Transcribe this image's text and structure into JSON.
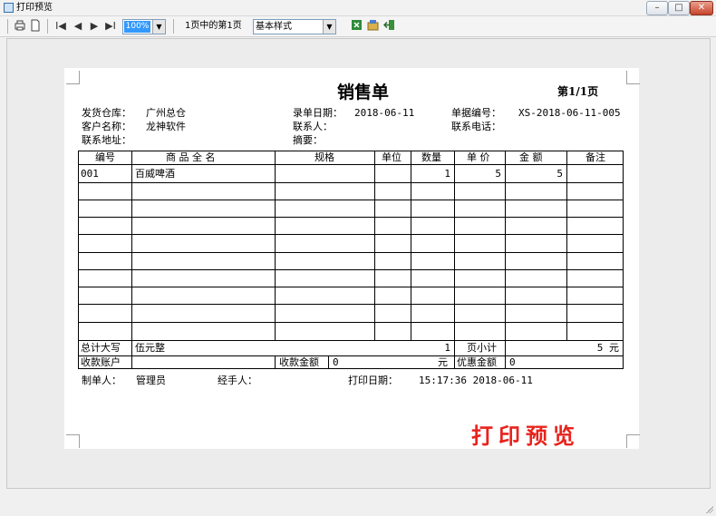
{
  "window": {
    "title": "打印预览",
    "min": "–",
    "max": "□",
    "close": "✕"
  },
  "toolbar": {
    "print_icon": "printer-icon",
    "page_setup_icon": "page-icon",
    "first_page": "I◀",
    "prev_page": "◀",
    "next_page": "▶",
    "last_page": "▶I",
    "zoom_value": "100%",
    "zoom_arrow": "▼",
    "page_label": "1页中的第1页",
    "style_value": "基本样式",
    "style_arrow": "▼",
    "excel_icon": "excel-icon",
    "design_icon": "design-icon",
    "exit_icon": "exit-icon"
  },
  "doc": {
    "title": "销售单",
    "page_no": "第1/1页",
    "warehouse_label": "发货仓库：",
    "warehouse_value": "广州总仓",
    "entry_date_label": "录单日期：",
    "entry_date_value": "2018-06-11",
    "doc_no_label": "单据编号：",
    "doc_no_value": "XS-2018-06-11-005",
    "customer_label": "客户名称：",
    "customer_value": "龙神软件",
    "contact_label": "联系人：",
    "phone_label": "联系电话：",
    "address_label": "联系地址：",
    "summary_label": "摘要："
  },
  "table": {
    "headers": [
      "编号",
      "商 品 全 名",
      "规格",
      "单位",
      "数量",
      "单 价",
      "金 额",
      "备注"
    ],
    "rows": [
      {
        "code": "001",
        "name": "百威啤酒",
        "spec": "",
        "unit": "",
        "qty": "1",
        "price": "5",
        "amount": "5",
        "note": ""
      }
    ],
    "total_label": "总计大写",
    "total_value": "伍元整",
    "total_qty": "1",
    "page_subtotal_label": "页小计",
    "page_subtotal_value": "5 元",
    "account_label": "收款账户",
    "received_label": "收款金额",
    "received_value": "0",
    "received_unit": "元",
    "discount_label": "优惠金额",
    "discount_value": "0"
  },
  "footer": {
    "maker_label": "制单人：",
    "maker_value": "管理员",
    "handler_label": "经手人：",
    "print_date_label": "打印日期：",
    "print_date_value": "15:17:36 2018-06-11"
  },
  "stamp": "打印预览"
}
